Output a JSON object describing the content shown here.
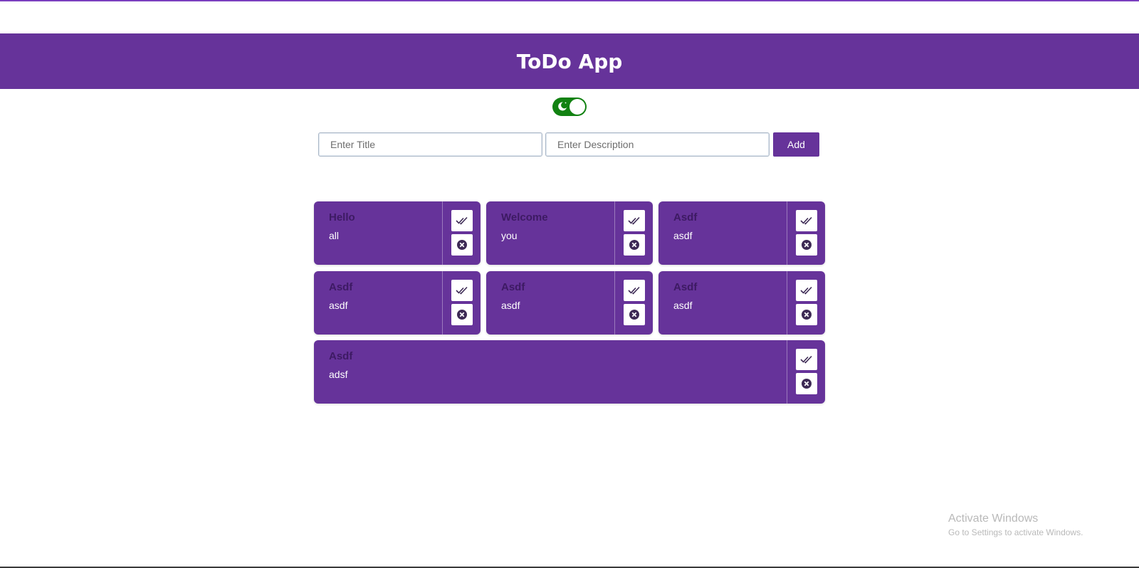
{
  "header": {
    "title": "ToDo App"
  },
  "theme_toggle": {
    "icon": "moon-icon",
    "state": "on",
    "color": "#128212"
  },
  "form": {
    "title_placeholder": "Enter Title",
    "title_value": "",
    "description_placeholder": "Enter Description",
    "description_value": "",
    "add_label": "Add"
  },
  "todos": [
    {
      "title": "Hello",
      "description": "all"
    },
    {
      "title": "Welcome",
      "description": "you"
    },
    {
      "title": "Asdf",
      "description": "asdf"
    },
    {
      "title": "Asdf",
      "description": "asdf"
    },
    {
      "title": "Asdf",
      "description": "asdf"
    },
    {
      "title": "Asdf",
      "description": "asdf"
    },
    {
      "title": "Asdf",
      "description": "adsf"
    }
  ],
  "card_actions": {
    "done_icon": "double-check-icon",
    "delete_icon": "close-circle-icon"
  },
  "watermark": {
    "line1": "Activate Windows",
    "line2": "Go to Settings to activate Windows."
  },
  "colors": {
    "accent": "#66339a",
    "title_text": "#3d1a63",
    "toggle_on": "#128212"
  }
}
